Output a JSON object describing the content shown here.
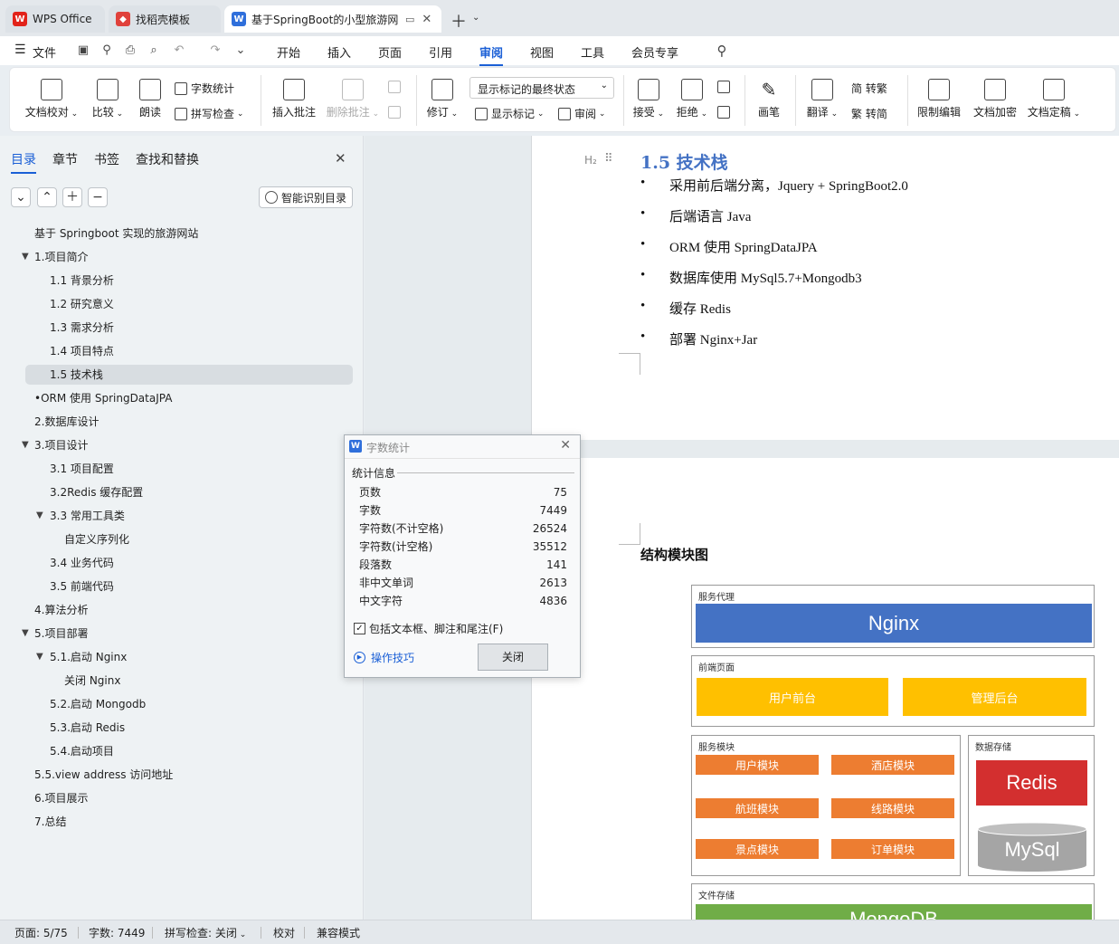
{
  "tabs": [
    {
      "label": "WPS Office"
    },
    {
      "label": "找稻壳模板"
    },
    {
      "label": "基于SpringBoot的小型旅游网"
    }
  ],
  "menu": {
    "file": "文件",
    "items": [
      "开始",
      "插入",
      "页面",
      "引用",
      "审阅",
      "视图",
      "工具",
      "会员专享"
    ],
    "active": "审阅"
  },
  "ribbon": {
    "proofread": "文档校对",
    "compare": "比较",
    "read_aloud": "朗读",
    "word_count": "字数统计",
    "spell_check": "拼写检查",
    "insert_comment": "插入批注",
    "delete_comment": "删除批注",
    "revise": "修订",
    "markup_state": "显示标记的最终状态",
    "show_markup": "显示标记",
    "review": "审阅",
    "accept": "接受",
    "reject": "拒绝",
    "pen": "画笔",
    "translate": "翻译",
    "simp_to_trad": "简 转繁",
    "trad_to_simp": "繁 转简",
    "restrict_edit": "限制编辑",
    "encrypt": "文档加密",
    "finalize": "文档定稿"
  },
  "nav": {
    "tabs": [
      "目录",
      "章节",
      "书签",
      "查找和替换"
    ],
    "smart_toc": "智能识别目录",
    "toc": [
      {
        "label": "基于 Springboot 实现的旅游网站",
        "level": 0,
        "caret": ""
      },
      {
        "label": "1.项目简介",
        "level": 0,
        "caret": "▼"
      },
      {
        "label": "1.1 背景分析",
        "level": 1,
        "caret": ""
      },
      {
        "label": "1.2 研究意义",
        "level": 1,
        "caret": ""
      },
      {
        "label": "1.3 需求分析",
        "level": 1,
        "caret": ""
      },
      {
        "label": "1.4 项目特点",
        "level": 1,
        "caret": ""
      },
      {
        "label": "1.5 技术栈",
        "level": 1,
        "caret": "",
        "selected": true
      },
      {
        "label": "•ORM 使用 SpringDataJPA",
        "level": 0,
        "caret": ""
      },
      {
        "label": "2.数据库设计",
        "level": 0,
        "caret": ""
      },
      {
        "label": "3.项目设计",
        "level": 0,
        "caret": "▼"
      },
      {
        "label": "3.1 项目配置",
        "level": 1,
        "caret": ""
      },
      {
        "label": "3.2Redis 缓存配置",
        "level": 1,
        "caret": ""
      },
      {
        "label": "3.3 常用工具类",
        "level": 1,
        "caret": "▼"
      },
      {
        "label": "自定义序列化",
        "level": 2,
        "caret": ""
      },
      {
        "label": "3.4 业务代码",
        "level": 1,
        "caret": ""
      },
      {
        "label": "3.5 前端代码",
        "level": 1,
        "caret": ""
      },
      {
        "label": "4.算法分析",
        "level": 0,
        "caret": ""
      },
      {
        "label": "5.项目部署",
        "level": 0,
        "caret": "▼"
      },
      {
        "label": "5.1.启动 Nginx",
        "level": 1,
        "caret": "▼"
      },
      {
        "label": "关闭 Nginx",
        "level": 2,
        "caret": ""
      },
      {
        "label": "5.2.启动 Mongodb",
        "level": 1,
        "caret": ""
      },
      {
        "label": "5.3.启动 Redis",
        "level": 1,
        "caret": ""
      },
      {
        "label": "5.4.启动项目",
        "level": 1,
        "caret": ""
      },
      {
        "label": "5.5.view address 访问地址",
        "level": 0,
        "caret": ""
      },
      {
        "label": "6.项目展示",
        "level": 0,
        "caret": ""
      },
      {
        "label": "7.总结",
        "level": 0,
        "caret": ""
      }
    ]
  },
  "doc": {
    "heading_marker": "H₂",
    "heading": "1.5 技术栈",
    "bullets": [
      "采用前后端分离，Jquery + SpringBoot2.0",
      "后端语言 Java",
      "ORM 使用 SpringDataJPA",
      "数据库使用 MySql5.7+Mongodb3",
      "缓存 Redis",
      "部署 Nginx+Jar"
    ],
    "section_title": "结构模块图",
    "diagram": {
      "proxy_label": "服务代理",
      "nginx": "Nginx",
      "frontend_label": "前端页面",
      "user_front": "用户前台",
      "admin_back": "管理后台",
      "service_label": "服务模块",
      "modules": [
        "用户模块",
        "酒店模块",
        "航班模块",
        "线路模块",
        "景点模块",
        "订单模块"
      ],
      "storage_label": "数据存储",
      "redis": "Redis",
      "mysql": "MySql",
      "file_label": "文件存储",
      "mongodb": "MongoDB"
    }
  },
  "dialog": {
    "title": "字数统计",
    "section": "统计信息",
    "rows": [
      {
        "k": "页数",
        "v": "75"
      },
      {
        "k": "字数",
        "v": "7449"
      },
      {
        "k": "字符数(不计空格)",
        "v": "26524"
      },
      {
        "k": "字符数(计空格)",
        "v": "35512"
      },
      {
        "k": "段落数",
        "v": "141"
      },
      {
        "k": "非中文单词",
        "v": "2613"
      },
      {
        "k": "中文字符",
        "v": "4836"
      }
    ],
    "checkbox_label": "包括文本框、脚注和尾注(F)",
    "tips": "操作技巧",
    "close": "关闭"
  },
  "status": {
    "page": "页面: 5/75",
    "words": "字数: 7449",
    "spell": "拼写检查: 关闭",
    "proof": "校对",
    "compat": "兼容模式"
  },
  "colors": {
    "accent": "#1a5fd6",
    "nginx": "#4472c4",
    "frontend": "#ffc000",
    "module": "#ed7d31",
    "redis": "#d32f2f",
    "mysql": "#a5a5a5",
    "mongodb": "#70ad47"
  }
}
